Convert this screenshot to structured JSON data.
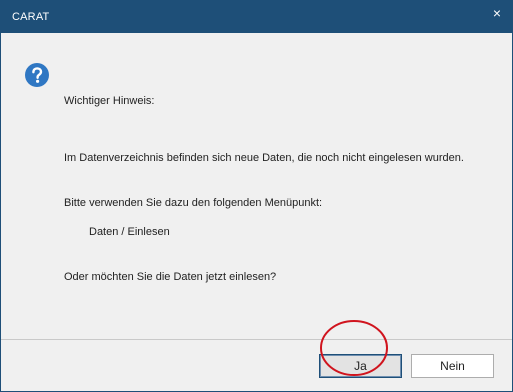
{
  "window": {
    "title": "CARAT",
    "close_label": "×"
  },
  "message": {
    "heading": "Wichtiger Hinweis:",
    "line1": "Im Datenverzeichnis befinden sich neue Daten, die noch nicht eingelesen wurden.",
    "line2": "Bitte verwenden Sie dazu den folgenden Menüpunkt:",
    "menu_path": "Daten / Einlesen",
    "question": "Oder möchten Sie die Daten jetzt einlesen?"
  },
  "buttons": {
    "yes_label": "Ja",
    "no_label": "Nein"
  },
  "icons": {
    "dialog_icon": "question-icon",
    "close_icon": "close-icon"
  },
  "colors": {
    "titlebar": "#1e4f78",
    "icon_fill": "#2f77c3",
    "annotation_circle": "#d0141e"
  }
}
